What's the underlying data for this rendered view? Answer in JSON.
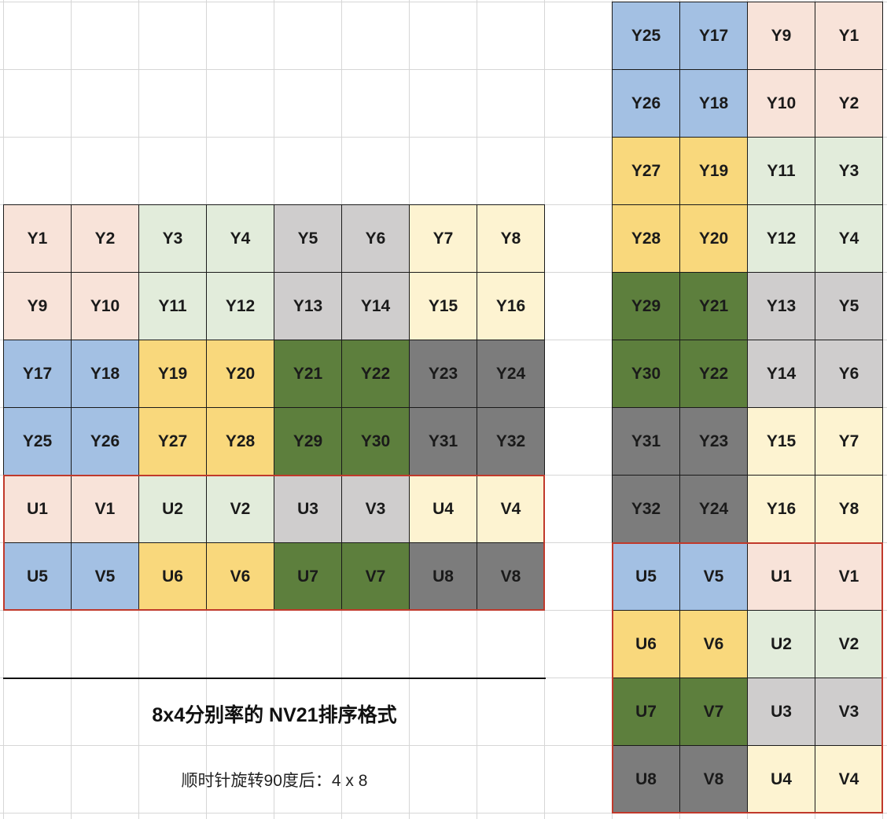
{
  "palette": {
    "peach": "#f8e3d9",
    "mint": "#e2ecdb",
    "silver": "#cfcdcd",
    "cream": "#fdf3d1",
    "blue": "#a3c0e3",
    "gold": "#f9d87c",
    "green": "#5d7f3d",
    "gray": "#7c7c7c",
    "red_border": "#c0392b"
  },
  "caption": {
    "title": "8x4分别率的 NV21排序格式",
    "subtitle": "顺时针旋转90度后：4 x 8"
  },
  "original_grid": {
    "rows": [
      [
        [
          "Y1",
          "peach"
        ],
        [
          "Y2",
          "peach"
        ],
        [
          "Y3",
          "mint"
        ],
        [
          "Y4",
          "mint"
        ],
        [
          "Y5",
          "silver"
        ],
        [
          "Y6",
          "silver"
        ],
        [
          "Y7",
          "cream"
        ],
        [
          "Y8",
          "cream"
        ]
      ],
      [
        [
          "Y9",
          "peach"
        ],
        [
          "Y10",
          "peach"
        ],
        [
          "Y11",
          "mint"
        ],
        [
          "Y12",
          "mint"
        ],
        [
          "Y13",
          "silver"
        ],
        [
          "Y14",
          "silver"
        ],
        [
          "Y15",
          "cream"
        ],
        [
          "Y16",
          "cream"
        ]
      ],
      [
        [
          "Y17",
          "blue"
        ],
        [
          "Y18",
          "blue"
        ],
        [
          "Y19",
          "gold"
        ],
        [
          "Y20",
          "gold"
        ],
        [
          "Y21",
          "green"
        ],
        [
          "Y22",
          "green"
        ],
        [
          "Y23",
          "gray"
        ],
        [
          "Y24",
          "gray"
        ]
      ],
      [
        [
          "Y25",
          "blue"
        ],
        [
          "Y26",
          "blue"
        ],
        [
          "Y27",
          "gold"
        ],
        [
          "Y28",
          "gold"
        ],
        [
          "Y29",
          "green"
        ],
        [
          "Y30",
          "green"
        ],
        [
          "Y31",
          "gray"
        ],
        [
          "Y32",
          "gray"
        ]
      ],
      [
        [
          "U1",
          "peach"
        ],
        [
          "V1",
          "peach"
        ],
        [
          "U2",
          "mint"
        ],
        [
          "V2",
          "mint"
        ],
        [
          "U3",
          "silver"
        ],
        [
          "V3",
          "silver"
        ],
        [
          "U4",
          "cream"
        ],
        [
          "V4",
          "cream"
        ]
      ],
      [
        [
          "U5",
          "blue"
        ],
        [
          "V5",
          "blue"
        ],
        [
          "U6",
          "gold"
        ],
        [
          "V6",
          "gold"
        ],
        [
          "U7",
          "green"
        ],
        [
          "V7",
          "green"
        ],
        [
          "U8",
          "gray"
        ],
        [
          "V8",
          "gray"
        ]
      ]
    ]
  },
  "rotated_grid": {
    "rows": [
      [
        [
          "Y25",
          "blue"
        ],
        [
          "Y17",
          "blue"
        ],
        [
          "Y9",
          "peach"
        ],
        [
          "Y1",
          "peach"
        ]
      ],
      [
        [
          "Y26",
          "blue"
        ],
        [
          "Y18",
          "blue"
        ],
        [
          "Y10",
          "peach"
        ],
        [
          "Y2",
          "peach"
        ]
      ],
      [
        [
          "Y27",
          "gold"
        ],
        [
          "Y19",
          "gold"
        ],
        [
          "Y11",
          "mint"
        ],
        [
          "Y3",
          "mint"
        ]
      ],
      [
        [
          "Y28",
          "gold"
        ],
        [
          "Y20",
          "gold"
        ],
        [
          "Y12",
          "mint"
        ],
        [
          "Y4",
          "mint"
        ]
      ],
      [
        [
          "Y29",
          "green"
        ],
        [
          "Y21",
          "green"
        ],
        [
          "Y13",
          "silver"
        ],
        [
          "Y5",
          "silver"
        ]
      ],
      [
        [
          "Y30",
          "green"
        ],
        [
          "Y22",
          "green"
        ],
        [
          "Y14",
          "silver"
        ],
        [
          "Y6",
          "silver"
        ]
      ],
      [
        [
          "Y31",
          "gray"
        ],
        [
          "Y23",
          "gray"
        ],
        [
          "Y15",
          "cream"
        ],
        [
          "Y7",
          "cream"
        ]
      ],
      [
        [
          "Y32",
          "gray"
        ],
        [
          "Y24",
          "gray"
        ],
        [
          "Y16",
          "cream"
        ],
        [
          "Y8",
          "cream"
        ]
      ],
      [
        [
          "U5",
          "blue"
        ],
        [
          "V5",
          "blue"
        ],
        [
          "U1",
          "peach"
        ],
        [
          "V1",
          "peach"
        ]
      ],
      [
        [
          "U6",
          "gold"
        ],
        [
          "V6",
          "gold"
        ],
        [
          "U2",
          "mint"
        ],
        [
          "V2",
          "mint"
        ]
      ],
      [
        [
          "U7",
          "green"
        ],
        [
          "V7",
          "green"
        ],
        [
          "U3",
          "silver"
        ],
        [
          "V3",
          "silver"
        ]
      ],
      [
        [
          "U8",
          "gray"
        ],
        [
          "V8",
          "gray"
        ],
        [
          "U4",
          "cream"
        ],
        [
          "V4",
          "cream"
        ]
      ]
    ]
  }
}
